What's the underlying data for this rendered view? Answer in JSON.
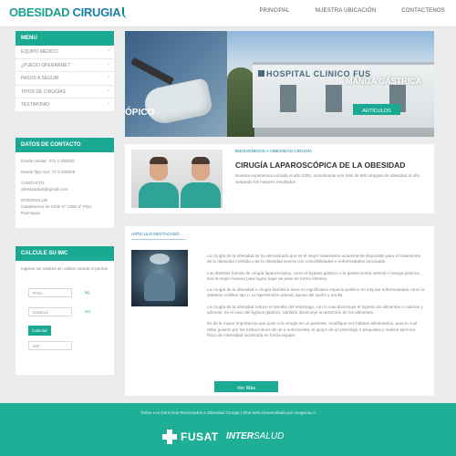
{
  "header": {
    "logo_main": "OBESIDAD",
    "logo_secondary": "CIRUGIA",
    "nav": [
      "PRINCIPAL",
      "NUESTRA UBICACIÓN",
      "CONTACTENOS"
    ]
  },
  "sidebar": {
    "menu_title": "MENU",
    "menu_items": [
      {
        "label": "EQUIPO MÉDICO"
      },
      {
        "label": "¿PUEDO OPERARME?"
      },
      {
        "label": "PASOS A SEGUIR"
      },
      {
        "label": "TIPOS DE CIRUGÍAS"
      },
      {
        "label": "TESTIMONIO"
      }
    ],
    "contact_title": "DATOS DE CONTACTO",
    "contact_lines": [
      "Desde celular: 072 2 200025",
      "Desde fijos Sur: 72 2 200025",
      "CONTACTO:\nobesidadsalt@gmail.com",
      "INTERSALUD\nCarabineros de Chile N° 1200 5° Piso, Rancagua"
    ],
    "imc_title": "CALCULE SU IMC",
    "imc_intro": "Ingrese los valores sin utilizar comas ni puntos",
    "imc_weight_placeholder": "Peso",
    "imc_weight_unit": "kg",
    "imc_height_placeholder": "Estatura",
    "imc_height_unit": "cm",
    "imc_button": "Calcular",
    "imc_result_placeholder": "IMC"
  },
  "slider": {
    "left_caption": "ÓPICO",
    "building_sign": "HOSPITAL CLINICO FUS",
    "caption": "MANGA GÁSTRICA",
    "button": "ARTÍCULOS"
  },
  "intro": {
    "breadcrumb": "BIENVENIDOS A OBESIDAD CIRUGÍA",
    "title": "CIRUGÍA LAPAROSCÓPICA DE LA OBESIDAD",
    "text": "Nuestra experiencia iniciada el año 2000, actualmente son más de 800 cirugías de obesidad al año, avalando los mejores resultados."
  },
  "article": {
    "label": "ARTICULO DESTACADO",
    "paragraphs": [
      "La cirugía de la obesidad se ha demostrado que es el mejor tratamiento actualmente disponible para el tratamiento de la obesidad mórbida o de la obesidad severa con comorbilidades o enfermedades asociadas.",
      "Las distintas formas de cirugía laparoscópica, como el bypass gástrico o la gastrectomía vertical o manga gástrica, son la mejor manera para lograr bajar de peso en forma efectiva.",
      "La cirugía de la obesidad o cirugía bariátrica tiene un significativo impacto positivo en mejorar enfermedades como la diabetes mellitus tipo II, la hipertensión arterial, apnea del sueño y artritis.",
      "La cirugía de la obesidad reduce el tamaño del estómago, con lo cual disminuye el ingreso de alimentos o calorías y además, en el caso del bypass gástrico, también disminuye la absorción de los alimentos.",
      "Es de la mayor importancia que junto a la cirugía en un paciente, modifique sus hábitos alimentarios, para lo cual debe guiarse por las instrucciones de un a nutricionista, el apoyo de un psicólogo o psiquiatra y realizar ejercicio físico de intensidad moderada en forma regular."
    ],
    "button": "Ver Más"
  },
  "footer": {
    "text": "Todos Los Derechos Reservados a Obesidad Cirugia | Sitio Web Desarrollado por Imagenia.cl",
    "logo1": "FUSAT",
    "logo2_a": "INTER",
    "logo2_b": "SALUD"
  },
  "colors": {
    "accent": "#1aaa93",
    "link": "#1a7fa6"
  }
}
